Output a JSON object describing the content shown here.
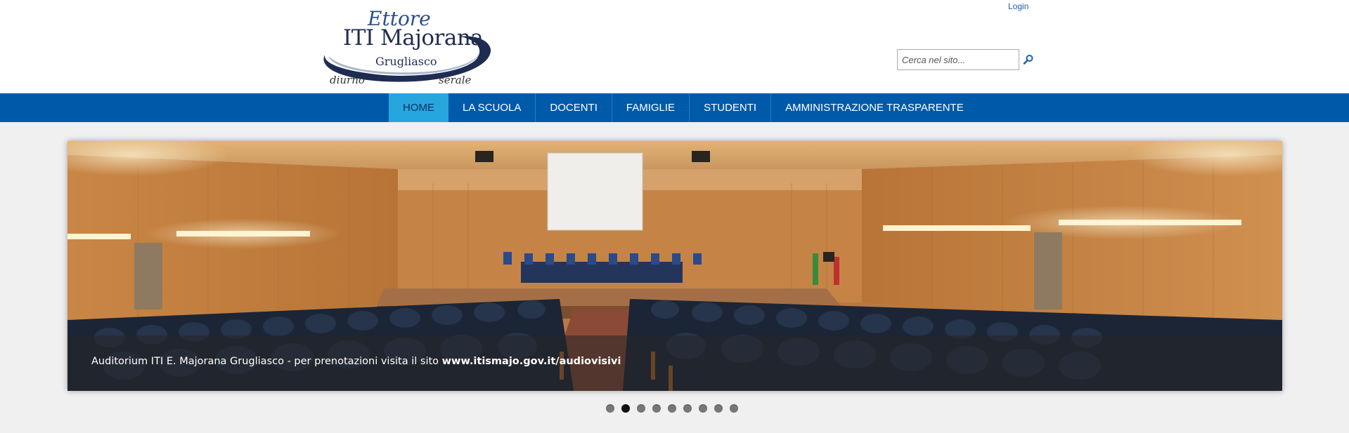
{
  "header": {
    "logo": {
      "main": "ITI Majorana",
      "script_top": "Ettore",
      "sub": "Grugliasco",
      "script_left": "diurno",
      "script_right": "serale"
    },
    "login_label": "Login",
    "search": {
      "placeholder": "Cerca nel sito..."
    },
    "search_icon": "search-icon"
  },
  "nav": {
    "items": [
      {
        "label": "HOME",
        "active": true
      },
      {
        "label": "LA SCUOLA",
        "active": false
      },
      {
        "label": "DOCENTI",
        "active": false
      },
      {
        "label": "FAMIGLIE",
        "active": false
      },
      {
        "label": "STUDENTI",
        "active": false
      },
      {
        "label": "AMMINISTRAZIONE TRASPARENTE",
        "active": false
      }
    ]
  },
  "slider": {
    "caption_text": "Auditorium ITI E. Majorana Grugliasco - per prenotazioni visita il sito ",
    "caption_link": "www.itismajo.gov.it/audiovisivi",
    "slide_count": 9,
    "active_index": 1
  },
  "colors": {
    "nav_bg": "#005aaa",
    "nav_active": "#27a6de",
    "page_bg": "#f0f0f0",
    "link": "#1f5fa8"
  }
}
